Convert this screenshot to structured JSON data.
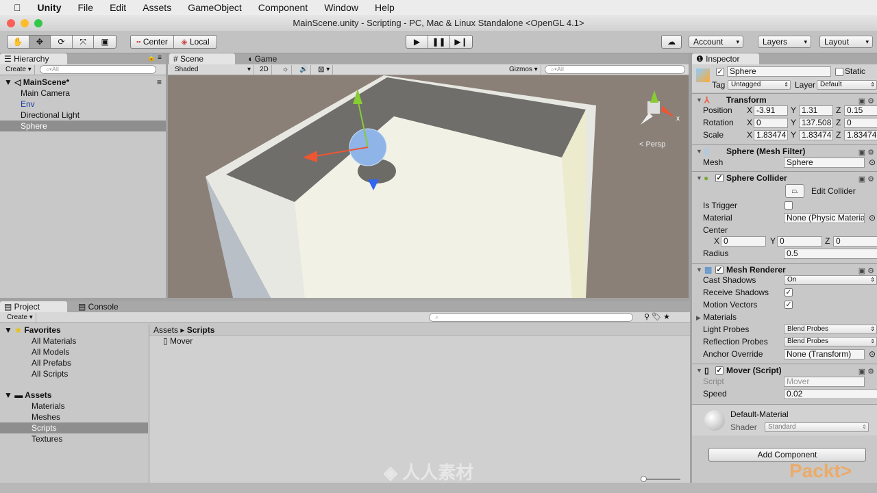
{
  "menu": {
    "app": "Unity",
    "items": [
      "File",
      "Edit",
      "Assets",
      "GameObject",
      "Component",
      "Window",
      "Help"
    ]
  },
  "window_title": "MainScene.unity - Scripting - PC, Mac & Linux Standalone <OpenGL 4.1>",
  "toolbar": {
    "tools": [
      "hand-icon",
      "move-icon",
      "rotate-icon",
      "scale-icon",
      "rect-icon"
    ],
    "active_tool": "move",
    "pivot": "Center",
    "space": "Local",
    "account": "Account",
    "layers": "Layers",
    "layout": "Layout"
  },
  "hierarchy": {
    "tab": "Hierarchy",
    "create": "Create",
    "search_placeholder": "All",
    "scene": "MainScene*",
    "items": [
      {
        "label": "Main Camera",
        "selected": false,
        "prefab": false
      },
      {
        "label": "Env",
        "selected": false,
        "prefab": true
      },
      {
        "label": "Directional Light",
        "selected": false,
        "prefab": false
      },
      {
        "label": "Sphere",
        "selected": true,
        "prefab": false
      }
    ]
  },
  "scene": {
    "tabs": [
      "Scene",
      "Game"
    ],
    "shading": "Shaded",
    "mode_2d": "2D",
    "gizmos": "Gizmos",
    "search_placeholder": "All",
    "persp": "< Persp",
    "colors": {
      "background": "#8a8077",
      "wall_inner": "#6f6e6b",
      "floor": "#f2f1e6",
      "sphere": "#8fb4e8"
    }
  },
  "project": {
    "tabs": [
      "Project",
      "Console"
    ],
    "create": "Create",
    "favorites": {
      "label": "Favorites",
      "items": [
        "All Materials",
        "All Models",
        "All Prefabs",
        "All Scripts"
      ]
    },
    "assets": {
      "label": "Assets",
      "items": [
        "Materials",
        "Meshes",
        "Scripts",
        "Textures"
      ],
      "selected": "Scripts"
    },
    "breadcrumb": [
      "Assets",
      "Scripts"
    ],
    "files": [
      "Mover"
    ]
  },
  "inspector": {
    "tab": "Inspector",
    "name": "Sphere",
    "active": true,
    "static_label": "Static",
    "tag_label": "Tag",
    "tag": "Untagged",
    "layer_label": "Layer",
    "layer": "Default",
    "transform": {
      "title": "Transform",
      "position": {
        "label": "Position",
        "x": "-3.91",
        "y": "1.31",
        "z": "0.15"
      },
      "rotation": {
        "label": "Rotation",
        "x": "0",
        "y": "137.508",
        "z": "0"
      },
      "scale": {
        "label": "Scale",
        "x": "1.83474",
        "y": "1.83474",
        "z": "1.83474"
      }
    },
    "mesh_filter": {
      "title": "Sphere (Mesh Filter)",
      "mesh_label": "Mesh",
      "mesh": "Sphere"
    },
    "sphere_collider": {
      "title": "Sphere Collider",
      "edit": "Edit Collider",
      "is_trigger_label": "Is Trigger",
      "is_trigger": false,
      "material_label": "Material",
      "material": "None (Physic Material)",
      "center_label": "Center",
      "center": {
        "x": "0",
        "y": "0",
        "z": "0"
      },
      "radius_label": "Radius",
      "radius": "0.5"
    },
    "mesh_renderer": {
      "title": "Mesh Renderer",
      "cast_shadows_label": "Cast Shadows",
      "cast_shadows": "On",
      "receive_shadows_label": "Receive Shadows",
      "receive_shadows": true,
      "motion_vectors_label": "Motion Vectors",
      "motion_vectors": true,
      "materials_label": "Materials",
      "light_probes_label": "Light Probes",
      "light_probes": "Blend Probes",
      "reflection_probes_label": "Reflection Probes",
      "reflection_probes": "Blend Probes",
      "anchor_label": "Anchor Override",
      "anchor": "None (Transform)"
    },
    "mover": {
      "title": "Mover (Script)",
      "script_label": "Script",
      "script": "Mover",
      "speed_label": "Speed",
      "speed": "0.02"
    },
    "material": {
      "name": "Default-Material",
      "shader_label": "Shader",
      "shader": "Standard"
    },
    "add_component": "Add Component"
  },
  "watermark": "人人素材",
  "brand": "Packt>"
}
